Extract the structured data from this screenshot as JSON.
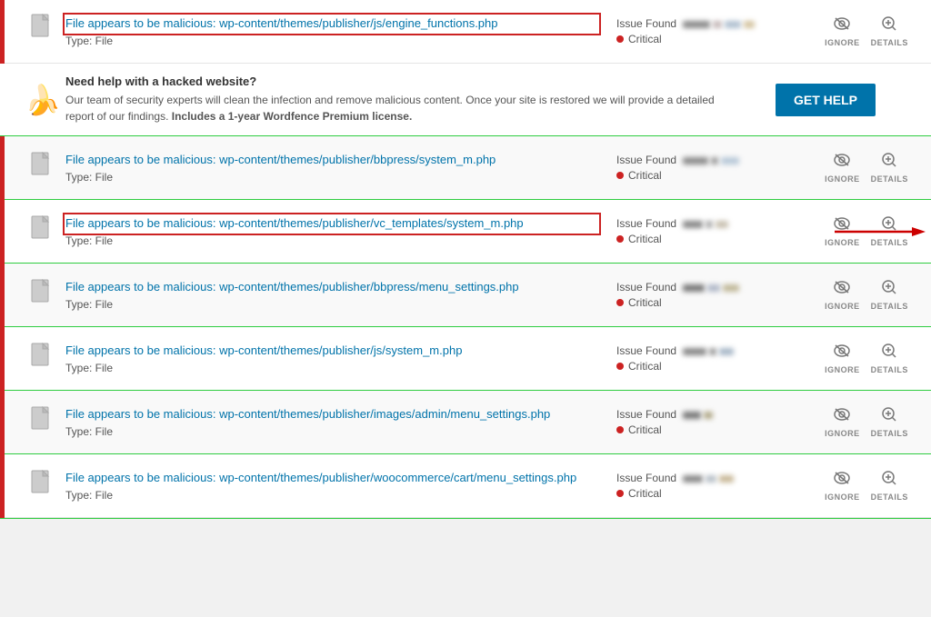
{
  "rows": [
    {
      "id": "row1",
      "type": "file",
      "highlighted": true,
      "fileLabel": "File appears to be malicious: wp-content/themes/publisher/js/engine_functions.php",
      "fileType": "Type: File",
      "issueFoundLabel": "Issue Found",
      "severity": "Critical",
      "hasRedBox": true,
      "ignoreLabel": "IGNORE",
      "detailsLabel": "DETAILS"
    },
    {
      "id": "row-help",
      "type": "help",
      "title": "Need help with a hacked website?",
      "description": "Our team of security experts will clean the infection and remove malicious content. Once your site is restored we will provide a detailed report of our findings. ",
      "boldPart": "Includes a 1-year Wordfence Premium license.",
      "buttonLabel": "GET HELP"
    },
    {
      "id": "row2",
      "type": "file",
      "fileLabel": "File appears to be malicious: wp-content/themes/publisher/bbpress/system_m.php",
      "fileType": "Type: File",
      "issueFoundLabel": "Issue Found",
      "severity": "Critical",
      "ignoreLabel": "IGNORE",
      "detailsLabel": "DETAILS"
    },
    {
      "id": "row3",
      "type": "file",
      "highlighted": true,
      "hasArrow": true,
      "fileLabel": "File appears to be malicious: wp-content/themes/publisher/vc_templates/system_m.php",
      "fileType": "Type: File",
      "issueFoundLabel": "Issue Found",
      "severity": "Critical",
      "ignoreLabel": "IGNoRE",
      "detailsLabel": "DETAILS"
    },
    {
      "id": "row4",
      "type": "file",
      "fileLabel": "File appears to be malicious: wp-content/themes/publisher/bbpress/menu_settings.php",
      "fileType": "Type: File",
      "issueFoundLabel": "Issue Found",
      "severity": "Critical",
      "ignoreLabel": "IGNORE",
      "detailsLabel": "DETAILS"
    },
    {
      "id": "row5",
      "type": "file",
      "fileLabel": "File appears to be malicious: wp-content/themes/publisher/js/system_m.php",
      "fileType": "Type: File",
      "issueFoundLabel": "Issue Found",
      "severity": "Critical",
      "ignoreLabel": "IGNORE",
      "detailsLabel": "DETAILS"
    },
    {
      "id": "row6",
      "type": "file",
      "fileLabel": "File appears to be malicious: wp-content/themes/publisher/images/admin/menu_settings.php",
      "fileType": "Type: File",
      "issueFoundLabel": "Issue Found",
      "severity": "Critical",
      "ignoreLabel": "IGNORE",
      "detailsLabel": "DETAILS"
    },
    {
      "id": "row7",
      "type": "file",
      "fileLabel": "File appears to be malicious: wp-content/themes/publisher/woocommerce/cart/menu_settings.php",
      "fileType": "Type: File",
      "issueFoundLabel": "Issue Found",
      "severity": "Critical",
      "ignoreLabel": "IGNORE",
      "detailsLabel": "DETAILS"
    }
  ],
  "icons": {
    "file": "🗋",
    "ignore": "👁",
    "details": "🔍",
    "banana": "🍌"
  }
}
